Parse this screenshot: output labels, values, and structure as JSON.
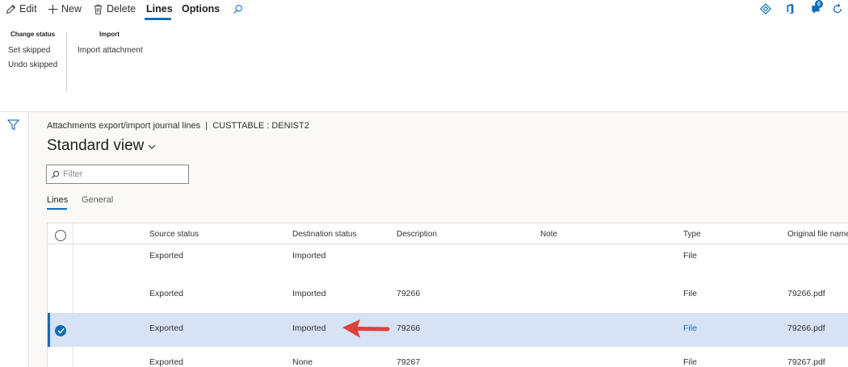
{
  "actionbar": {
    "edit": "Edit",
    "new": "New",
    "delete": "Delete",
    "lines": "Lines",
    "options": "Options",
    "notification_count": "0"
  },
  "ribbon": {
    "change_status": {
      "title": "Change status",
      "items": [
        "Set skipped",
        "Undo skipped"
      ]
    },
    "import": {
      "title": "Import",
      "items": [
        "Import attachment"
      ]
    }
  },
  "page": {
    "breadcrumb": "Attachments export/import journal lines  |  CUSTTABLE : DENIST2",
    "view_title": "Standard view",
    "filter_placeholder": "Filter",
    "tabs": [
      "Lines",
      "General"
    ]
  },
  "grid": {
    "columns": [
      "Source status",
      "Destination status",
      "Description",
      "Note",
      "Type",
      "Original file name"
    ],
    "rows": [
      {
        "source": "Exported",
        "destination": "Imported",
        "description": "",
        "note": "",
        "type": "File",
        "file": "",
        "selected": false
      },
      {
        "source": "Exported",
        "destination": "Imported",
        "description": "79266",
        "note": "",
        "type": "File",
        "file": "79266.pdf",
        "selected": false
      },
      {
        "source": "Exported",
        "destination": "Imported",
        "description": "79266",
        "note": "",
        "type": "File",
        "file": "79266.pdf",
        "selected": true
      },
      {
        "source": "Exported",
        "destination": "None",
        "description": "79267",
        "note": "",
        "type": "File",
        "file": "79267.pdf",
        "selected": false
      }
    ]
  },
  "colors": {
    "accent": "#0f6cbd",
    "selected_row": "#d7e2f4",
    "arrow": "#e0403a"
  }
}
